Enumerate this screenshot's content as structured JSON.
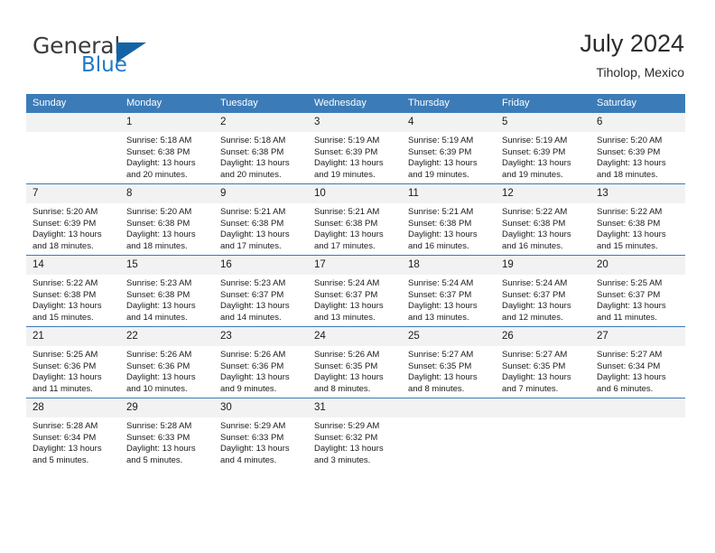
{
  "brand": {
    "name_part1": "General",
    "name_part2": "Blue"
  },
  "header": {
    "title": "July 2024",
    "subtitle": "Tiholop, Mexico"
  },
  "colors": {
    "header_blue": "#3b7cb8",
    "daynum_bg": "#f2f2f2",
    "logo_blue": "#2079c7",
    "text": "#1a1a1a"
  },
  "weekday_headers": [
    "Sunday",
    "Monday",
    "Tuesday",
    "Wednesday",
    "Thursday",
    "Friday",
    "Saturday"
  ],
  "weeks": [
    [
      {
        "day": "",
        "lines": []
      },
      {
        "day": "1",
        "lines": [
          "Sunrise: 5:18 AM",
          "Sunset: 6:38 PM",
          "Daylight: 13 hours",
          "and 20 minutes."
        ]
      },
      {
        "day": "2",
        "lines": [
          "Sunrise: 5:18 AM",
          "Sunset: 6:38 PM",
          "Daylight: 13 hours",
          "and 20 minutes."
        ]
      },
      {
        "day": "3",
        "lines": [
          "Sunrise: 5:19 AM",
          "Sunset: 6:39 PM",
          "Daylight: 13 hours",
          "and 19 minutes."
        ]
      },
      {
        "day": "4",
        "lines": [
          "Sunrise: 5:19 AM",
          "Sunset: 6:39 PM",
          "Daylight: 13 hours",
          "and 19 minutes."
        ]
      },
      {
        "day": "5",
        "lines": [
          "Sunrise: 5:19 AM",
          "Sunset: 6:39 PM",
          "Daylight: 13 hours",
          "and 19 minutes."
        ]
      },
      {
        "day": "6",
        "lines": [
          "Sunrise: 5:20 AM",
          "Sunset: 6:39 PM",
          "Daylight: 13 hours",
          "and 18 minutes."
        ]
      }
    ],
    [
      {
        "day": "7",
        "lines": [
          "Sunrise: 5:20 AM",
          "Sunset: 6:39 PM",
          "Daylight: 13 hours",
          "and 18 minutes."
        ]
      },
      {
        "day": "8",
        "lines": [
          "Sunrise: 5:20 AM",
          "Sunset: 6:38 PM",
          "Daylight: 13 hours",
          "and 18 minutes."
        ]
      },
      {
        "day": "9",
        "lines": [
          "Sunrise: 5:21 AM",
          "Sunset: 6:38 PM",
          "Daylight: 13 hours",
          "and 17 minutes."
        ]
      },
      {
        "day": "10",
        "lines": [
          "Sunrise: 5:21 AM",
          "Sunset: 6:38 PM",
          "Daylight: 13 hours",
          "and 17 minutes."
        ]
      },
      {
        "day": "11",
        "lines": [
          "Sunrise: 5:21 AM",
          "Sunset: 6:38 PM",
          "Daylight: 13 hours",
          "and 16 minutes."
        ]
      },
      {
        "day": "12",
        "lines": [
          "Sunrise: 5:22 AM",
          "Sunset: 6:38 PM",
          "Daylight: 13 hours",
          "and 16 minutes."
        ]
      },
      {
        "day": "13",
        "lines": [
          "Sunrise: 5:22 AM",
          "Sunset: 6:38 PM",
          "Daylight: 13 hours",
          "and 15 minutes."
        ]
      }
    ],
    [
      {
        "day": "14",
        "lines": [
          "Sunrise: 5:22 AM",
          "Sunset: 6:38 PM",
          "Daylight: 13 hours",
          "and 15 minutes."
        ]
      },
      {
        "day": "15",
        "lines": [
          "Sunrise: 5:23 AM",
          "Sunset: 6:38 PM",
          "Daylight: 13 hours",
          "and 14 minutes."
        ]
      },
      {
        "day": "16",
        "lines": [
          "Sunrise: 5:23 AM",
          "Sunset: 6:37 PM",
          "Daylight: 13 hours",
          "and 14 minutes."
        ]
      },
      {
        "day": "17",
        "lines": [
          "Sunrise: 5:24 AM",
          "Sunset: 6:37 PM",
          "Daylight: 13 hours",
          "and 13 minutes."
        ]
      },
      {
        "day": "18",
        "lines": [
          "Sunrise: 5:24 AM",
          "Sunset: 6:37 PM",
          "Daylight: 13 hours",
          "and 13 minutes."
        ]
      },
      {
        "day": "19",
        "lines": [
          "Sunrise: 5:24 AM",
          "Sunset: 6:37 PM",
          "Daylight: 13 hours",
          "and 12 minutes."
        ]
      },
      {
        "day": "20",
        "lines": [
          "Sunrise: 5:25 AM",
          "Sunset: 6:37 PM",
          "Daylight: 13 hours",
          "and 11 minutes."
        ]
      }
    ],
    [
      {
        "day": "21",
        "lines": [
          "Sunrise: 5:25 AM",
          "Sunset: 6:36 PM",
          "Daylight: 13 hours",
          "and 11 minutes."
        ]
      },
      {
        "day": "22",
        "lines": [
          "Sunrise: 5:26 AM",
          "Sunset: 6:36 PM",
          "Daylight: 13 hours",
          "and 10 minutes."
        ]
      },
      {
        "day": "23",
        "lines": [
          "Sunrise: 5:26 AM",
          "Sunset: 6:36 PM",
          "Daylight: 13 hours",
          "and 9 minutes."
        ]
      },
      {
        "day": "24",
        "lines": [
          "Sunrise: 5:26 AM",
          "Sunset: 6:35 PM",
          "Daylight: 13 hours",
          "and 8 minutes."
        ]
      },
      {
        "day": "25",
        "lines": [
          "Sunrise: 5:27 AM",
          "Sunset: 6:35 PM",
          "Daylight: 13 hours",
          "and 8 minutes."
        ]
      },
      {
        "day": "26",
        "lines": [
          "Sunrise: 5:27 AM",
          "Sunset: 6:35 PM",
          "Daylight: 13 hours",
          "and 7 minutes."
        ]
      },
      {
        "day": "27",
        "lines": [
          "Sunrise: 5:27 AM",
          "Sunset: 6:34 PM",
          "Daylight: 13 hours",
          "and 6 minutes."
        ]
      }
    ],
    [
      {
        "day": "28",
        "lines": [
          "Sunrise: 5:28 AM",
          "Sunset: 6:34 PM",
          "Daylight: 13 hours",
          "and 5 minutes."
        ]
      },
      {
        "day": "29",
        "lines": [
          "Sunrise: 5:28 AM",
          "Sunset: 6:33 PM",
          "Daylight: 13 hours",
          "and 5 minutes."
        ]
      },
      {
        "day": "30",
        "lines": [
          "Sunrise: 5:29 AM",
          "Sunset: 6:33 PM",
          "Daylight: 13 hours",
          "and 4 minutes."
        ]
      },
      {
        "day": "31",
        "lines": [
          "Sunrise: 5:29 AM",
          "Sunset: 6:32 PM",
          "Daylight: 13 hours",
          "and 3 minutes."
        ]
      },
      {
        "day": "",
        "lines": []
      },
      {
        "day": "",
        "lines": []
      },
      {
        "day": "",
        "lines": []
      }
    ]
  ]
}
